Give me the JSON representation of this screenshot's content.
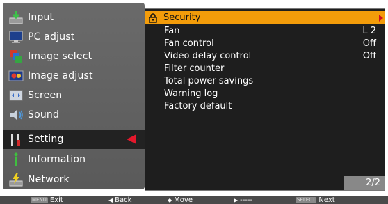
{
  "left_menu": {
    "items": [
      {
        "label": "Input",
        "icon": "input-icon"
      },
      {
        "label": "PC adjust",
        "icon": "pc-adjust-icon"
      },
      {
        "label": "Image select",
        "icon": "image-select-icon"
      },
      {
        "label": "Image adjust",
        "icon": "image-adjust-icon"
      },
      {
        "label": "Screen",
        "icon": "screen-icon"
      },
      {
        "label": "Sound",
        "icon": "sound-icon"
      },
      {
        "label": "Setting",
        "icon": "setting-icon"
      },
      {
        "label": "Information",
        "icon": "information-icon"
      },
      {
        "label": "Network",
        "icon": "network-icon"
      }
    ],
    "selected": "Setting"
  },
  "right_panel": {
    "rows": [
      {
        "label": "Security",
        "value": "",
        "highlighted": true
      },
      {
        "label": "Fan",
        "value": "L 2"
      },
      {
        "label": "Fan control",
        "value": "Off"
      },
      {
        "label": "Video delay control",
        "value": "Off"
      },
      {
        "label": "Filter counter",
        "value": ""
      },
      {
        "label": "Total power savings",
        "value": ""
      },
      {
        "label": "Warning log",
        "value": ""
      },
      {
        "label": "Factory default",
        "value": ""
      }
    ],
    "page_indicator": "2/2"
  },
  "bottom_bar": {
    "exit_key": "MENU",
    "exit_label": "Exit",
    "back_label": "Back",
    "move_label": "Move",
    "right_label": "-----",
    "next_key": "SELECT",
    "next_label": "Next"
  },
  "colors": {
    "highlight": "#f39c0a",
    "arrow_red": "#e4182c",
    "panel_bg": "#1e1e1e",
    "menu_bg": "#666666"
  }
}
